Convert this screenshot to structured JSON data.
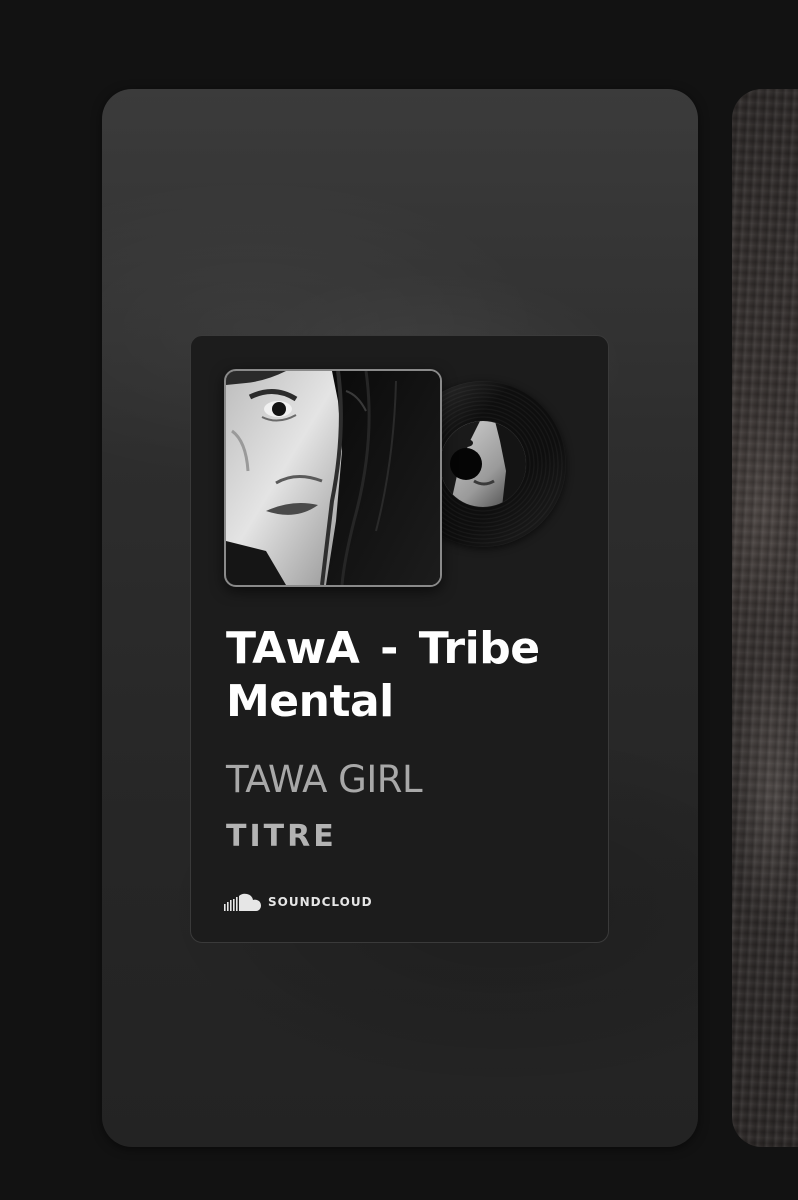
{
  "track": {
    "title": "TAwA - Tribe Mental",
    "artist": "TAWA GIRL",
    "type_label": "TITRE"
  },
  "source": {
    "name": "SOUNDCLOUD",
    "icon": "soundcloud-icon"
  },
  "colors": {
    "page_background": "#121212",
    "card_background": "#1c1c1c",
    "title_text": "#ffffff",
    "artist_text": "#a8a8a8"
  }
}
